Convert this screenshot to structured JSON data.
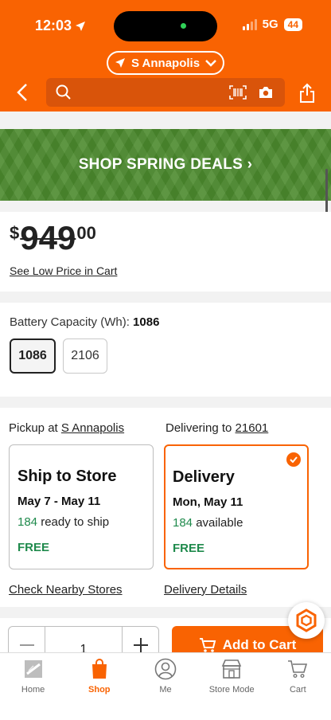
{
  "status_bar": {
    "time": "12:03",
    "network": "5G",
    "battery": "44"
  },
  "header": {
    "store_name": "S Annapolis"
  },
  "banner": {
    "text": "SHOP SPRING DEALS ›"
  },
  "price": {
    "currency": "$",
    "dollars": "949",
    "cents": "00",
    "see_low_price": "See Low Price in Cart"
  },
  "battery_capacity": {
    "label": "Battery Capacity (Wh):",
    "selected_value": "1086",
    "options": [
      "1086",
      "2106"
    ]
  },
  "fulfillment": {
    "pickup_label": "Pickup at",
    "pickup_store": "S Annapolis",
    "delivery_label": "Delivering to",
    "delivery_zip": "21601",
    "ship_to_store": {
      "title": "Ship to Store",
      "dates": "May 7 - May 11",
      "count": "184",
      "status": "ready to ship",
      "price": "FREE"
    },
    "delivery": {
      "title": "Delivery",
      "dates": "Mon, May 11",
      "count": "184",
      "status": "available",
      "price": "FREE",
      "selected": true
    },
    "check_nearby": "Check Nearby Stores",
    "delivery_details": "Delivery Details"
  },
  "cart": {
    "quantity": "1",
    "add_to_cart": "Add to Cart"
  },
  "bottom_nav": {
    "items": [
      {
        "label": "Home",
        "icon": "home-depot-logo-icon"
      },
      {
        "label": "Shop",
        "icon": "shop-bag-icon",
        "active": true
      },
      {
        "label": "Me",
        "icon": "person-icon"
      },
      {
        "label": "Store Mode",
        "icon": "store-icon"
      },
      {
        "label": "Cart",
        "icon": "cart-icon"
      }
    ]
  },
  "colors": {
    "brand_orange": "#f96302",
    "banner_green": "#4c8a2e",
    "free_green": "#1f8a4c"
  }
}
